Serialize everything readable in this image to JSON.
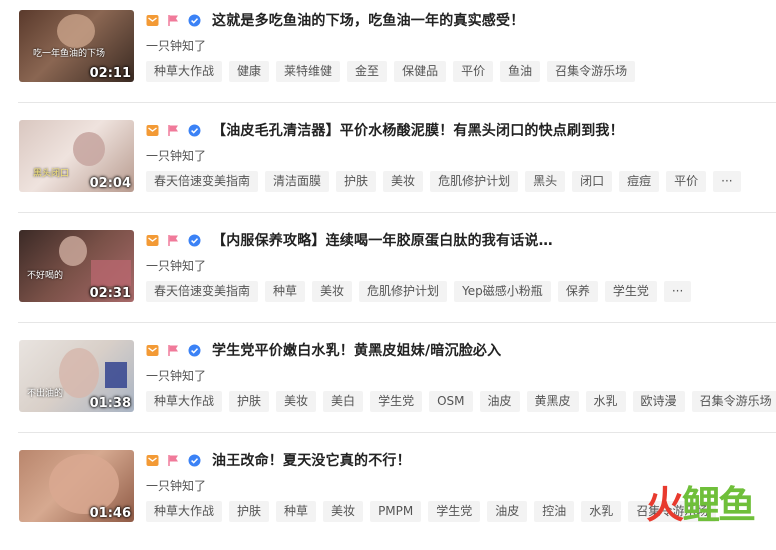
{
  "items": [
    {
      "duration": "02:11",
      "thumb_caption": "吃一年鱼油的下场",
      "title": "这就是多吃鱼油的下场，吃鱼油一年的真实感受！",
      "author": "一只钟知了",
      "tags": [
        "种草大作战",
        "健康",
        "莱特维健",
        "金至",
        "保健品",
        "平价",
        "鱼油",
        "召集令游乐场"
      ]
    },
    {
      "duration": "02:04",
      "thumb_caption": "黑头闭口",
      "title": "【油皮毛孔清洁器】平价水杨酸泥膜！有黑头闭口的快点刷到我！",
      "author": "一只钟知了",
      "tags": [
        "春天倍速变美指南",
        "清洁面膜",
        "护肤",
        "美妆",
        "危肌修护计划",
        "黑头",
        "闭口",
        "痘痘",
        "平价",
        "···"
      ]
    },
    {
      "duration": "02:31",
      "thumb_caption": "不好喝的",
      "title": "【内服保养攻略】连续喝一年胶原蛋白肽的我有话说…",
      "author": "一只钟知了",
      "tags": [
        "春天倍速变美指南",
        "种草",
        "美妆",
        "危肌修护计划",
        "Yep磁感小粉瓶",
        "保养",
        "学生党",
        "···"
      ]
    },
    {
      "duration": "01:38",
      "thumb_caption": "不出油的",
      "title": "学生党平价嫩白水乳！黄黑皮姐妹/暗沉脸必入",
      "author": "一只钟知了",
      "tags": [
        "种草大作战",
        "护肤",
        "美妆",
        "美白",
        "学生党",
        "OSM",
        "油皮",
        "黄黑皮",
        "水乳",
        "欧诗漫",
        "召集令游乐场"
      ]
    },
    {
      "duration": "01:46",
      "thumb_caption": "",
      "title": "油王改命！夏天没它真的不行！",
      "author": "一只钟知了",
      "tags": [
        "种草大作战",
        "护肤",
        "种草",
        "美妆",
        "PMPM",
        "学生党",
        "油皮",
        "控油",
        "水乳",
        "召集令游乐场"
      ]
    }
  ],
  "watermark": {
    "a": "火",
    "b": "鲤鱼"
  },
  "colors": {
    "tag_bg": "#f3f3f3",
    "orange_icon": "#f39a35",
    "pink_flag": "#f07a9a",
    "blue_badge": "#3b82f6"
  }
}
